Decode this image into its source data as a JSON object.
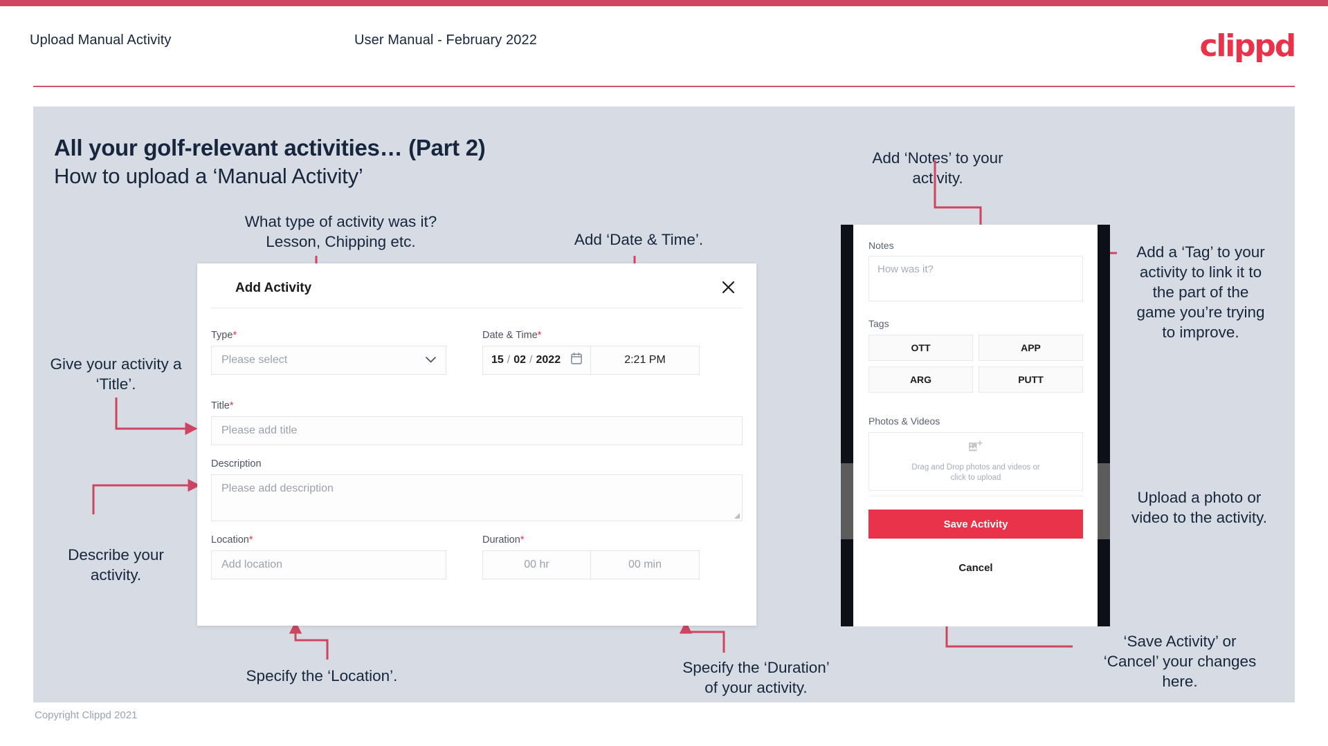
{
  "header": {
    "left_title": "Upload Manual Activity",
    "center_title": "User Manual - February 2022",
    "logo": "clippd"
  },
  "slide": {
    "title_line1": "All your golf-relevant activities… (Part 2)",
    "title_line2": "How to upload a ‘Manual Activity’",
    "copyright": "Copyright Clippd 2021"
  },
  "dialog": {
    "title": "Add Activity",
    "close_icon": "close-icon",
    "fields": {
      "type": {
        "label": "Type",
        "required": "*",
        "placeholder": "Please select",
        "chevron_icon": "chevron-down-icon"
      },
      "datetime": {
        "label": "Date & Time",
        "required": "*",
        "day": "15",
        "sep1": "/",
        "month": "02",
        "sep2": "/",
        "year": "2022",
        "calendar_icon": "calendar-icon",
        "time": "2:21 PM"
      },
      "title": {
        "label": "Title",
        "required": "*",
        "placeholder": "Please add title"
      },
      "description": {
        "label": "Description",
        "required": "",
        "placeholder": "Please add description"
      },
      "location": {
        "label": "Location",
        "required": "*",
        "placeholder": "Add location"
      },
      "duration": {
        "label": "Duration",
        "required": "*",
        "hours_placeholder": "00 hr",
        "minutes_placeholder": "00 min"
      }
    }
  },
  "phone": {
    "notes": {
      "label": "Notes",
      "placeholder": "How was it?"
    },
    "tags": {
      "label": "Tags",
      "items": [
        "OTT",
        "APP",
        "ARG",
        "PUTT"
      ]
    },
    "photos": {
      "label": "Photos & Videos",
      "upload_icon": "add-image-icon",
      "dropzone_line1": "Drag and Drop photos and videos or",
      "dropzone_line2": "click to upload"
    },
    "save_label": "Save Activity",
    "cancel_label": "Cancel"
  },
  "annotations": {
    "type": "What type of activity was it?\nLesson, Chipping etc.",
    "datetime": "Add ‘Date & Time’.",
    "notes": "Add ‘Notes’ to your\nactivity.",
    "tags": "Add a ‘Tag’ to your\nactivity to link it to\nthe part of the\ngame you’re trying\nto improve.",
    "title": "Give your activity a\n‘Title’.",
    "description": "Describe your\nactivity.",
    "location": "Specify the ‘Location’.",
    "duration": "Specify the ‘Duration’\nof your activity.",
    "photos": "Upload a photo or\nvideo to the activity.",
    "save": "‘Save Activity’ or\n‘Cancel’ your changes\nhere."
  },
  "colors": {
    "brand_red": "#e8334a",
    "arrow_red": "#cd4560",
    "slide_bg": "#d7dce4",
    "ink": "#17263c"
  }
}
